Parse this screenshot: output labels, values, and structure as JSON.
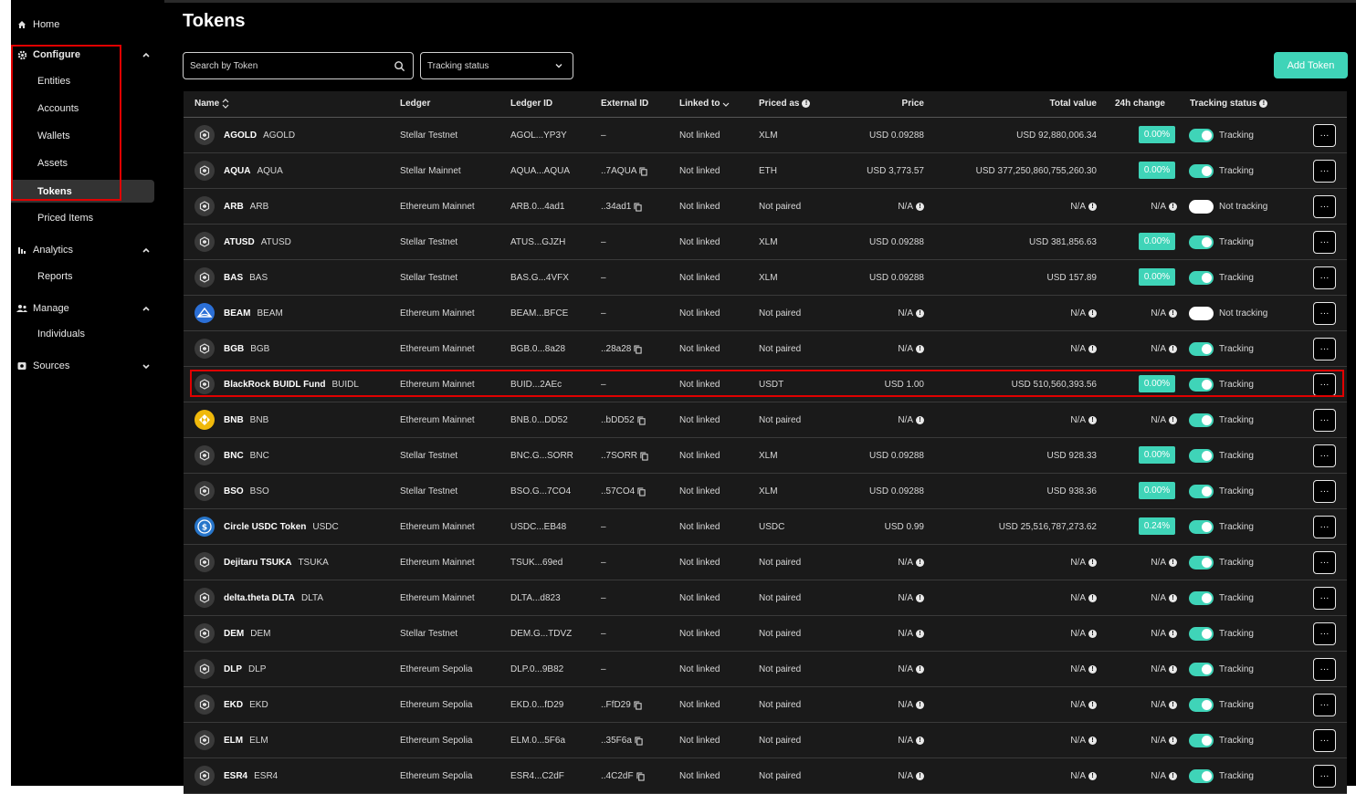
{
  "sidebar": {
    "home": "Home",
    "configure": "Configure",
    "configure_items": [
      "Entities",
      "Accounts",
      "Wallets",
      "Assets",
      "Tokens"
    ],
    "priced_items": "Priced Items",
    "analytics": "Analytics",
    "analytics_items": [
      "Reports"
    ],
    "manage": "Manage",
    "manage_items": [
      "Individuals"
    ],
    "sources": "Sources"
  },
  "page": {
    "title": "Tokens",
    "search_placeholder": "Search by Token",
    "tracking_select": "Tracking status",
    "add_button": "Add Token"
  },
  "table": {
    "headers": {
      "name": "Name",
      "ledger": "Ledger",
      "ledger_id": "Ledger ID",
      "external_id": "External ID",
      "linked_to": "Linked to",
      "priced_as": "Priced as",
      "price": "Price",
      "total_value": "Total value",
      "change": "24h change",
      "tracking": "Tracking status"
    },
    "rows": [
      {
        "name": "AGOLD",
        "symbol": "AGOLD",
        "ledger": "Stellar Testnet",
        "ledger_id": "AGOL...YP3Y",
        "external_id": "–",
        "linked": "Not linked",
        "priced_as": "XLM",
        "price": "USD  0.09288",
        "total": "USD  92,880,006.34",
        "change": "0.00%",
        "tracking": "Tracking",
        "on": true,
        "icon": "generic"
      },
      {
        "name": "AQUA",
        "symbol": "AQUA",
        "ledger": "Stellar Mainnet",
        "ledger_id": "AQUA...AQUA",
        "external_id": "..7AQUA",
        "linked": "Not linked",
        "priced_as": "ETH",
        "price": "USD  3,773.57",
        "total": "USD  377,250,860,755,260.30",
        "change": "0.00%",
        "tracking": "Tracking",
        "on": true,
        "icon": "generic"
      },
      {
        "name": "ARB",
        "symbol": "ARB",
        "ledger": "Ethereum Mainnet",
        "ledger_id": "ARB.0...4ad1",
        "external_id": "..34ad1",
        "linked": "Not linked",
        "priced_as": "Not paired",
        "price": "N/A",
        "total": "N/A",
        "change": "N/A",
        "tracking": "Not tracking",
        "on": false,
        "icon": "generic"
      },
      {
        "name": "ATUSD",
        "symbol": "ATUSD",
        "ledger": "Stellar Testnet",
        "ledger_id": "ATUS...GJZH",
        "external_id": "–",
        "linked": "Not linked",
        "priced_as": "XLM",
        "price": "USD  0.09288",
        "total": "USD  381,856.63",
        "change": "0.00%",
        "tracking": "Tracking",
        "on": true,
        "icon": "generic"
      },
      {
        "name": "BAS",
        "symbol": "BAS",
        "ledger": "Stellar Testnet",
        "ledger_id": "BAS.G...4VFX",
        "external_id": "–",
        "linked": "Not linked",
        "priced_as": "XLM",
        "price": "USD  0.09288",
        "total": "USD  157.89",
        "change": "0.00%",
        "tracking": "Tracking",
        "on": true,
        "icon": "generic"
      },
      {
        "name": "BEAM",
        "symbol": "BEAM",
        "ledger": "Ethereum Mainnet",
        "ledger_id": "BEAM...BFCE",
        "external_id": "–",
        "linked": "Not linked",
        "priced_as": "Not paired",
        "price": "N/A",
        "total": "N/A",
        "change": "N/A",
        "tracking": "Not tracking",
        "on": false,
        "icon": "beam"
      },
      {
        "name": "BGB",
        "symbol": "BGB",
        "ledger": "Ethereum Mainnet",
        "ledger_id": "BGB.0...8a28",
        "external_id": "..28a28",
        "linked": "Not linked",
        "priced_as": "Not paired",
        "price": "N/A",
        "total": "N/A",
        "change": "N/A",
        "tracking": "Tracking",
        "on": true,
        "icon": "generic"
      },
      {
        "name": "BlackRock BUIDL Fund",
        "symbol": "BUIDL",
        "ledger": "Ethereum Mainnet",
        "ledger_id": "BUID...2AEc",
        "external_id": "–",
        "linked": "Not linked",
        "priced_as": "USDT",
        "price": "USD  1.00",
        "total": "USD  510,560,393.56",
        "change": "0.00%",
        "tracking": "Tracking",
        "on": true,
        "icon": "generic"
      },
      {
        "name": "BNB",
        "symbol": "BNB",
        "ledger": "Ethereum Mainnet",
        "ledger_id": "BNB.0...DD52",
        "external_id": "..bDD52",
        "linked": "Not linked",
        "priced_as": "Not paired",
        "price": "N/A",
        "total": "N/A",
        "change": "N/A",
        "tracking": "Tracking",
        "on": true,
        "icon": "bnb"
      },
      {
        "name": "BNC",
        "symbol": "BNC",
        "ledger": "Stellar Testnet",
        "ledger_id": "BNC.G...SORR",
        "external_id": "..7SORR",
        "linked": "Not linked",
        "priced_as": "XLM",
        "price": "USD  0.09288",
        "total": "USD  928.33",
        "change": "0.00%",
        "tracking": "Tracking",
        "on": true,
        "icon": "generic"
      },
      {
        "name": "BSO",
        "symbol": "BSO",
        "ledger": "Stellar Testnet",
        "ledger_id": "BSO.G...7CO4",
        "external_id": "..57CO4",
        "linked": "Not linked",
        "priced_as": "XLM",
        "price": "USD  0.09288",
        "total": "USD  938.36",
        "change": "0.00%",
        "tracking": "Tracking",
        "on": true,
        "icon": "generic"
      },
      {
        "name": "Circle USDC Token",
        "symbol": "USDC",
        "ledger": "Ethereum Mainnet",
        "ledger_id": "USDC...EB48",
        "external_id": "–",
        "linked": "Not linked",
        "priced_as": "USDC",
        "price": "USD  0.99",
        "total": "USD  25,516,787,273.62",
        "change": "0.24%",
        "tracking": "Tracking",
        "on": true,
        "icon": "usdc"
      },
      {
        "name": "Dejitaru TSUKA",
        "symbol": "TSUKA",
        "ledger": "Ethereum Mainnet",
        "ledger_id": "TSUK...69ed",
        "external_id": "–",
        "linked": "Not linked",
        "priced_as": "Not paired",
        "price": "N/A",
        "total": "N/A",
        "change": "N/A",
        "tracking": "Tracking",
        "on": true,
        "icon": "generic"
      },
      {
        "name": "delta.theta DLTA",
        "symbol": "DLTA",
        "ledger": "Ethereum Mainnet",
        "ledger_id": "DLTA...d823",
        "external_id": "–",
        "linked": "Not linked",
        "priced_as": "Not paired",
        "price": "N/A",
        "total": "N/A",
        "change": "N/A",
        "tracking": "Tracking",
        "on": true,
        "icon": "generic"
      },
      {
        "name": "DEM",
        "symbol": "DEM",
        "ledger": "Stellar Testnet",
        "ledger_id": "DEM.G...TDVZ",
        "external_id": "–",
        "linked": "Not linked",
        "priced_as": "Not paired",
        "price": "N/A",
        "total": "N/A",
        "change": "N/A",
        "tracking": "Tracking",
        "on": true,
        "icon": "generic"
      },
      {
        "name": "DLP",
        "symbol": "DLP",
        "ledger": "Ethereum Sepolia",
        "ledger_id": "DLP.0...9B82",
        "external_id": "–",
        "linked": "Not linked",
        "priced_as": "Not paired",
        "price": "N/A",
        "total": "N/A",
        "change": "N/A",
        "tracking": "Tracking",
        "on": true,
        "icon": "generic"
      },
      {
        "name": "EKD",
        "symbol": "EKD",
        "ledger": "Ethereum Sepolia",
        "ledger_id": "EKD.0...fD29",
        "external_id": "..FfD29",
        "linked": "Not linked",
        "priced_as": "Not paired",
        "price": "N/A",
        "total": "N/A",
        "change": "N/A",
        "tracking": "Tracking",
        "on": true,
        "icon": "generic"
      },
      {
        "name": "ELM",
        "symbol": "ELM",
        "ledger": "Ethereum Sepolia",
        "ledger_id": "ELM.0...5F6a",
        "external_id": "..35F6a",
        "linked": "Not linked",
        "priced_as": "Not paired",
        "price": "N/A",
        "total": "N/A",
        "change": "N/A",
        "tracking": "Tracking",
        "on": true,
        "icon": "generic"
      },
      {
        "name": "ESR4",
        "symbol": "ESR4",
        "ledger": "Ethereum Sepolia",
        "ledger_id": "ESR4...C2dF",
        "external_id": "..4C2dF",
        "linked": "Not linked",
        "priced_as": "Not paired",
        "price": "N/A",
        "total": "N/A",
        "change": "N/A",
        "tracking": "Tracking",
        "on": true,
        "icon": "generic"
      }
    ]
  },
  "colors": {
    "accent": "#3fd4b8",
    "highlight": "#e00000",
    "background": "#000000"
  }
}
